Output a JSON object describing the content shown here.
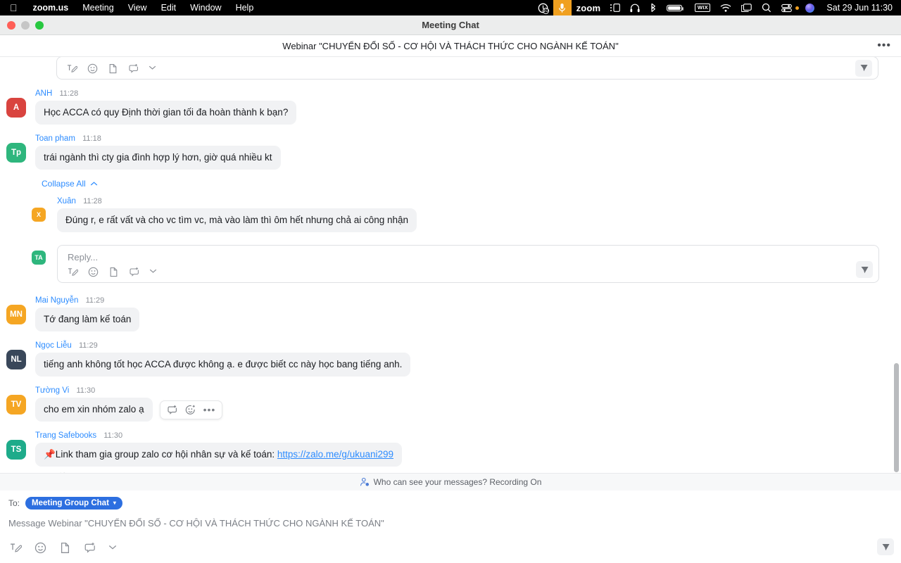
{
  "os_menubar": {
    "apple_icon": "apple-logo-icon",
    "items": [
      {
        "label": "zoom.us",
        "bold": true
      },
      {
        "label": "Meeting",
        "bold": false
      },
      {
        "label": "View",
        "bold": false
      },
      {
        "label": "Edit",
        "bold": false
      },
      {
        "label": "Window",
        "bold": false
      },
      {
        "label": "Help",
        "bold": false
      }
    ],
    "status_icons": [
      "timer-badge-10-icon",
      "microphone-active-icon",
      "zoom-wordmark-icon",
      "sidebar-list-icon",
      "headphones-icon",
      "bluetooth-icon",
      "battery-icon",
      "wix-icon",
      "wifi-icon",
      "screen-mirroring-icon",
      "spotlight-search-icon",
      "control-center-icon",
      "siri-icon"
    ],
    "zoom_wordmark": "zoom",
    "wix_label": "WIX",
    "badge_count": "10",
    "clock": "Sat 29 Jun  11:30"
  },
  "window": {
    "title": "Meeting Chat",
    "traffic_lights": [
      "close-button",
      "minimize-button",
      "maximize-button"
    ]
  },
  "chat_header": {
    "title": "Webinar \"CHUYỂN ĐỔI SỐ - CƠ HỘI VÀ THÁCH THỨC CHO NGÀNH KẾ TOÁN\"",
    "more_label": "•••"
  },
  "toolbar_icons": [
    "format-text-icon",
    "emoji-icon",
    "file-attachment-icon",
    "screenshot-icon",
    "chevron-down-icon"
  ],
  "send_icon": "send-arrow-icon",
  "messages": [
    {
      "id": "anh",
      "author": "ANH",
      "time": "11:28",
      "initials": "A",
      "avatar_color": "#d9443f",
      "text": "Học ACCA có quy Định thời gian tối đa hoàn thành k bạn?"
    },
    {
      "id": "toan-pham",
      "author": "Toan pham",
      "time": "11:18",
      "initials": "Tp",
      "avatar_color": "#2eb67d",
      "text": "trái ngành thì cty gia đình hợp lý hơn, giờ quá nhiều kt"
    },
    {
      "id": "mai-nguyen",
      "author": "Mai Nguyễn",
      "time": "11:29",
      "initials": "MN",
      "avatar_color": "#f5a623",
      "text": "Tớ đang làm kế toán"
    },
    {
      "id": "ngoc-lieu",
      "author": "Ngọc Liễu",
      "time": "11:29",
      "initials": "NL",
      "avatar_color": "#39475a",
      "text": "tiếng anh không tốt học ACCA được không ạ. e được biết cc này học bang tiếng anh."
    },
    {
      "id": "tuong-vi",
      "author": "Tường Vi",
      "time": "11:30",
      "initials": "TV",
      "avatar_color": "#f5a623",
      "text": "cho em xin nhóm zalo ạ"
    },
    {
      "id": "trang-safebooks",
      "author": "Trang Safebooks",
      "time": "11:30",
      "initials": "TS",
      "avatar_color": "#1eab8a",
      "text_prefix": "📌Link tham gia group zalo cơ hội nhân sự và kế toán: ",
      "link_text": "https://zalo.me/g/ukuani299"
    }
  ],
  "thread": {
    "collapse_label": "Collapse All",
    "collapse_icon": "chevron-up-icon",
    "reply": {
      "author": "Xuân",
      "time": "11:28",
      "initials": "X",
      "avatar_color": "#f5a623",
      "text": "Đúng r,  e rất vất và cho vc tìm vc, mà vào làm thì ôm hết nhưng chả ai công nhận"
    },
    "reply_box": {
      "initials": "TA",
      "avatar_color": "#2eb67d",
      "placeholder": "Reply..."
    }
  },
  "hover_actions": {
    "reply_icon": "reply-in-thread-icon",
    "react_icon": "add-reaction-icon",
    "more_icon": "more-options-icon",
    "more_label": "•••"
  },
  "privacy_bar": {
    "icon": "who-can-see-icon",
    "text": "Who can see your messages? Recording On"
  },
  "composer": {
    "to_label": "To:",
    "recipient": "Meeting Group Chat",
    "recipient_caret": "▾",
    "placeholder": "Message Webinar \"CHUYỂN ĐỔI SỐ - CƠ HỘI VÀ THÁCH THỨC CHO NGÀNH KẾ TOÁN\""
  },
  "colors": {
    "accent_blue": "#2d8cff",
    "pill_blue": "#2d6fe0",
    "bubble_gray": "#f1f2f4",
    "menubar_black": "#000000",
    "mic_orange": "#f0a020"
  }
}
